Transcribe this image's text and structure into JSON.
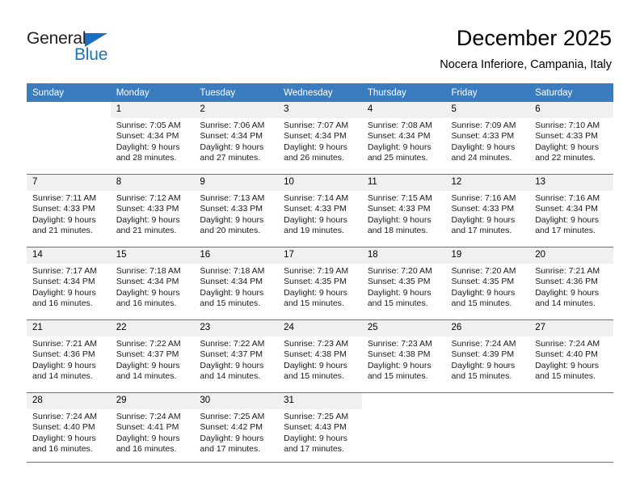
{
  "brand": {
    "word1": "General",
    "word2": "Blue",
    "triangle_color": "#1b6ec2",
    "blue_color": "#1b75bb"
  },
  "header": {
    "title": "December 2025",
    "subtitle": "Nocera Inferiore, Campania, Italy"
  },
  "theme": {
    "header_row_bg": "#3a7cbe",
    "daynum_bg": "#f0f0f0",
    "grid_line": "#3a7cbe",
    "text": "#000000"
  },
  "weekday_headers": [
    "Sunday",
    "Monday",
    "Tuesday",
    "Wednesday",
    "Thursday",
    "Friday",
    "Saturday"
  ],
  "weeks": [
    [
      {
        "day": "",
        "blank": true,
        "sunrise": "",
        "sunset": "",
        "daylight1": "",
        "daylight2": ""
      },
      {
        "day": "1",
        "sunrise": "Sunrise: 7:05 AM",
        "sunset": "Sunset: 4:34 PM",
        "daylight1": "Daylight: 9 hours",
        "daylight2": "and 28 minutes."
      },
      {
        "day": "2",
        "sunrise": "Sunrise: 7:06 AM",
        "sunset": "Sunset: 4:34 PM",
        "daylight1": "Daylight: 9 hours",
        "daylight2": "and 27 minutes."
      },
      {
        "day": "3",
        "sunrise": "Sunrise: 7:07 AM",
        "sunset": "Sunset: 4:34 PM",
        "daylight1": "Daylight: 9 hours",
        "daylight2": "and 26 minutes."
      },
      {
        "day": "4",
        "sunrise": "Sunrise: 7:08 AM",
        "sunset": "Sunset: 4:34 PM",
        "daylight1": "Daylight: 9 hours",
        "daylight2": "and 25 minutes."
      },
      {
        "day": "5",
        "sunrise": "Sunrise: 7:09 AM",
        "sunset": "Sunset: 4:33 PM",
        "daylight1": "Daylight: 9 hours",
        "daylight2": "and 24 minutes."
      },
      {
        "day": "6",
        "sunrise": "Sunrise: 7:10 AM",
        "sunset": "Sunset: 4:33 PM",
        "daylight1": "Daylight: 9 hours",
        "daylight2": "and 22 minutes."
      }
    ],
    [
      {
        "day": "7",
        "sunrise": "Sunrise: 7:11 AM",
        "sunset": "Sunset: 4:33 PM",
        "daylight1": "Daylight: 9 hours",
        "daylight2": "and 21 minutes."
      },
      {
        "day": "8",
        "sunrise": "Sunrise: 7:12 AM",
        "sunset": "Sunset: 4:33 PM",
        "daylight1": "Daylight: 9 hours",
        "daylight2": "and 21 minutes."
      },
      {
        "day": "9",
        "sunrise": "Sunrise: 7:13 AM",
        "sunset": "Sunset: 4:33 PM",
        "daylight1": "Daylight: 9 hours",
        "daylight2": "and 20 minutes."
      },
      {
        "day": "10",
        "sunrise": "Sunrise: 7:14 AM",
        "sunset": "Sunset: 4:33 PM",
        "daylight1": "Daylight: 9 hours",
        "daylight2": "and 19 minutes."
      },
      {
        "day": "11",
        "sunrise": "Sunrise: 7:15 AM",
        "sunset": "Sunset: 4:33 PM",
        "daylight1": "Daylight: 9 hours",
        "daylight2": "and 18 minutes."
      },
      {
        "day": "12",
        "sunrise": "Sunrise: 7:16 AM",
        "sunset": "Sunset: 4:33 PM",
        "daylight1": "Daylight: 9 hours",
        "daylight2": "and 17 minutes."
      },
      {
        "day": "13",
        "sunrise": "Sunrise: 7:16 AM",
        "sunset": "Sunset: 4:34 PM",
        "daylight1": "Daylight: 9 hours",
        "daylight2": "and 17 minutes."
      }
    ],
    [
      {
        "day": "14",
        "sunrise": "Sunrise: 7:17 AM",
        "sunset": "Sunset: 4:34 PM",
        "daylight1": "Daylight: 9 hours",
        "daylight2": "and 16 minutes."
      },
      {
        "day": "15",
        "sunrise": "Sunrise: 7:18 AM",
        "sunset": "Sunset: 4:34 PM",
        "daylight1": "Daylight: 9 hours",
        "daylight2": "and 16 minutes."
      },
      {
        "day": "16",
        "sunrise": "Sunrise: 7:18 AM",
        "sunset": "Sunset: 4:34 PM",
        "daylight1": "Daylight: 9 hours",
        "daylight2": "and 15 minutes."
      },
      {
        "day": "17",
        "sunrise": "Sunrise: 7:19 AM",
        "sunset": "Sunset: 4:35 PM",
        "daylight1": "Daylight: 9 hours",
        "daylight2": "and 15 minutes."
      },
      {
        "day": "18",
        "sunrise": "Sunrise: 7:20 AM",
        "sunset": "Sunset: 4:35 PM",
        "daylight1": "Daylight: 9 hours",
        "daylight2": "and 15 minutes."
      },
      {
        "day": "19",
        "sunrise": "Sunrise: 7:20 AM",
        "sunset": "Sunset: 4:35 PM",
        "daylight1": "Daylight: 9 hours",
        "daylight2": "and 15 minutes."
      },
      {
        "day": "20",
        "sunrise": "Sunrise: 7:21 AM",
        "sunset": "Sunset: 4:36 PM",
        "daylight1": "Daylight: 9 hours",
        "daylight2": "and 14 minutes."
      }
    ],
    [
      {
        "day": "21",
        "sunrise": "Sunrise: 7:21 AM",
        "sunset": "Sunset: 4:36 PM",
        "daylight1": "Daylight: 9 hours",
        "daylight2": "and 14 minutes."
      },
      {
        "day": "22",
        "sunrise": "Sunrise: 7:22 AM",
        "sunset": "Sunset: 4:37 PM",
        "daylight1": "Daylight: 9 hours",
        "daylight2": "and 14 minutes."
      },
      {
        "day": "23",
        "sunrise": "Sunrise: 7:22 AM",
        "sunset": "Sunset: 4:37 PM",
        "daylight1": "Daylight: 9 hours",
        "daylight2": "and 14 minutes."
      },
      {
        "day": "24",
        "sunrise": "Sunrise: 7:23 AM",
        "sunset": "Sunset: 4:38 PM",
        "daylight1": "Daylight: 9 hours",
        "daylight2": "and 15 minutes."
      },
      {
        "day": "25",
        "sunrise": "Sunrise: 7:23 AM",
        "sunset": "Sunset: 4:38 PM",
        "daylight1": "Daylight: 9 hours",
        "daylight2": "and 15 minutes."
      },
      {
        "day": "26",
        "sunrise": "Sunrise: 7:24 AM",
        "sunset": "Sunset: 4:39 PM",
        "daylight1": "Daylight: 9 hours",
        "daylight2": "and 15 minutes."
      },
      {
        "day": "27",
        "sunrise": "Sunrise: 7:24 AM",
        "sunset": "Sunset: 4:40 PM",
        "daylight1": "Daylight: 9 hours",
        "daylight2": "and 15 minutes."
      }
    ],
    [
      {
        "day": "28",
        "sunrise": "Sunrise: 7:24 AM",
        "sunset": "Sunset: 4:40 PM",
        "daylight1": "Daylight: 9 hours",
        "daylight2": "and 16 minutes."
      },
      {
        "day": "29",
        "sunrise": "Sunrise: 7:24 AM",
        "sunset": "Sunset: 4:41 PM",
        "daylight1": "Daylight: 9 hours",
        "daylight2": "and 16 minutes."
      },
      {
        "day": "30",
        "sunrise": "Sunrise: 7:25 AM",
        "sunset": "Sunset: 4:42 PM",
        "daylight1": "Daylight: 9 hours",
        "daylight2": "and 17 minutes."
      },
      {
        "day": "31",
        "sunrise": "Sunrise: 7:25 AM",
        "sunset": "Sunset: 4:43 PM",
        "daylight1": "Daylight: 9 hours",
        "daylight2": "and 17 minutes."
      },
      {
        "day": "",
        "blank": true,
        "sunrise": "",
        "sunset": "",
        "daylight1": "",
        "daylight2": ""
      },
      {
        "day": "",
        "blank": true,
        "sunrise": "",
        "sunset": "",
        "daylight1": "",
        "daylight2": ""
      },
      {
        "day": "",
        "blank": true,
        "sunrise": "",
        "sunset": "",
        "daylight1": "",
        "daylight2": ""
      }
    ]
  ]
}
